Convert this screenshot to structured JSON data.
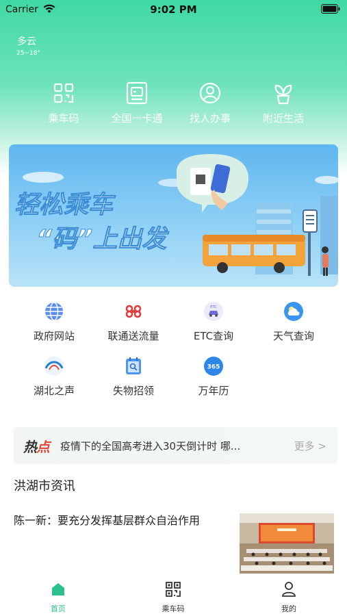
{
  "status_bar": {
    "carrier": "Carrier",
    "time": "9:02 PM"
  },
  "weather": {
    "condition": "多云",
    "range": "25~18°"
  },
  "quick_actions": [
    {
      "label": "乘车码",
      "icon": "qr-code-icon"
    },
    {
      "label": "全国一卡通",
      "icon": "transit-card-icon"
    },
    {
      "label": "找人办事",
      "icon": "person-search-icon"
    },
    {
      "label": "附近生活",
      "icon": "sprout-icon"
    }
  ],
  "banner": {
    "line1": "轻松乘车",
    "line2": "“码”上出发"
  },
  "services": [
    {
      "label": "政府网站",
      "icon": "globe-icon"
    },
    {
      "label": "联通送流量",
      "icon": "unicom-icon"
    },
    {
      "label": "ETC查询",
      "icon": "etc-car-icon"
    },
    {
      "label": "天气查询",
      "icon": "weather-icon"
    },
    {
      "label": "湖北之声",
      "icon": "hubei-voice-icon"
    },
    {
      "label": "失物招领",
      "icon": "lost-found-icon"
    },
    {
      "label": "万年历",
      "icon": "calendar-365-icon"
    }
  ],
  "hot": {
    "tag_a": "热",
    "tag_b": "点",
    "text": "疫情下的全国高考进入30天倒计时 哪...",
    "more": "更多 >"
  },
  "section_title": "洪湖市资讯",
  "news": [
    {
      "title": "陈一新：要充分发挥基层群众自治作用"
    }
  ],
  "tabs": [
    {
      "label": "首页",
      "active": true
    },
    {
      "label": "乘车码",
      "active": false
    },
    {
      "label": "我的",
      "active": false
    }
  ],
  "colors": {
    "accent": "#2cc08d",
    "header_top": "#3fd9a3",
    "hot_red": "#e04b3c"
  }
}
